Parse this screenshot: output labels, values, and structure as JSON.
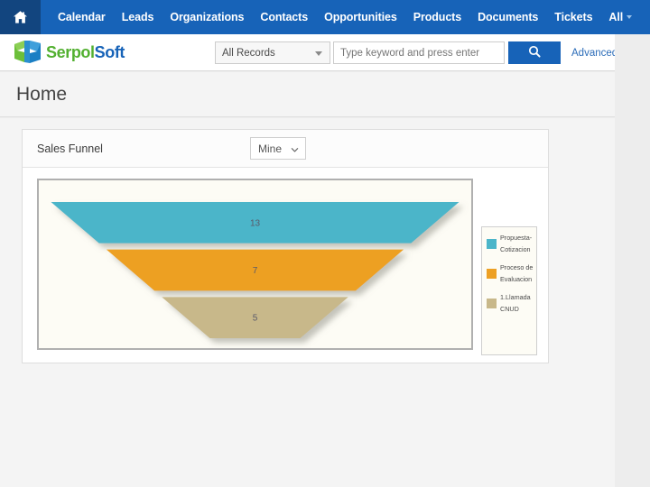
{
  "topnav": {
    "home_icon": "home-icon",
    "items": [
      {
        "label": "Calendar"
      },
      {
        "label": "Leads"
      },
      {
        "label": "Organizations"
      },
      {
        "label": "Contacts"
      },
      {
        "label": "Opportunities"
      },
      {
        "label": "Products"
      },
      {
        "label": "Documents"
      },
      {
        "label": "Tickets"
      }
    ],
    "all_label": "All"
  },
  "header": {
    "logo_primary": "Serpol",
    "logo_secondary": "Soft",
    "logo_icon": "serpolsoft-logo-icon"
  },
  "search": {
    "scope_value": "All Records",
    "placeholder": "Type keyword and press enter",
    "input_value": "",
    "search_icon": "search-icon",
    "advanced_label": "Advanced"
  },
  "page": {
    "title": "Home"
  },
  "widget": {
    "title": "Sales Funnel",
    "filter_value": "Mine",
    "filter_icon": "chevron-down-icon"
  },
  "chart_data": {
    "type": "funnel",
    "title": "Sales Funnel",
    "categories": [
      "Propuesta-Cotizacion",
      "Proceso de Evaluacion",
      "1.Llamada CNUD"
    ],
    "values": [
      13,
      7,
      5
    ],
    "colors": [
      "#4bb5c9",
      "#eda024",
      "#c8b88a"
    ],
    "legend_position": "right",
    "legend_entries": [
      {
        "label": "Propuesta-Cotizacion",
        "lines": [
          "Propuesta-",
          "Cotizacion"
        ],
        "color": "#4bb5c9",
        "value": 13
      },
      {
        "label": "Proceso de Evaluacion",
        "lines": [
          "Proceso",
          "de",
          "Evaluacion"
        ],
        "color": "#eda024",
        "value": 7
      },
      {
        "label": "1.Llamada CNUD",
        "lines": [
          "1.Llamada",
          "CNUD"
        ],
        "color": "#c8b88a",
        "value": 5
      }
    ],
    "data_labels": [
      "13",
      "7",
      "5"
    ],
    "grid": false,
    "plot_background": "#fdfcf5"
  },
  "colors": {
    "nav_blue": "#1763b8",
    "nav_blue_dark": "#12457f",
    "accent_link": "#2b6cb8",
    "logo_green": "#52b030",
    "logo_blue": "#1763b8"
  }
}
